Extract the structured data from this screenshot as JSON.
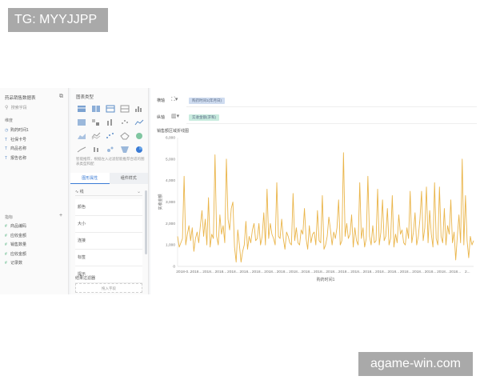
{
  "watermarks": {
    "top": "TG: MYYJJPP",
    "bottom": "agame-win.com"
  },
  "data_panel": {
    "title": "药品销售数据表",
    "search_placeholder": "搜索字段",
    "dimensions_label": "维度",
    "dimensions": [
      {
        "icon": "clock-icon",
        "label": "购药时间1"
      },
      {
        "icon": "text-icon",
        "label": "社保卡号"
      },
      {
        "icon": "text-icon",
        "label": "商品名称"
      },
      {
        "icon": "text-icon",
        "label": "报告名称"
      }
    ],
    "measures_label": "指标",
    "measures_add": "+",
    "measures": [
      {
        "label": "商品编码"
      },
      {
        "label": "应收金额"
      },
      {
        "label": "销售数量"
      },
      {
        "label": "应收金额"
      },
      {
        "label": "记录数"
      }
    ]
  },
  "chart_panel": {
    "title": "图表类型",
    "hint": "智能推荐，根据左入过滤智能推荐合适的图表类型和配",
    "tab_active": "图形属性",
    "tab_inactive": "组件样式",
    "line_selector": "线",
    "properties": [
      "颜色",
      "大小",
      "连接",
      "标签",
      "提示"
    ],
    "filter_title": "结果过滤器",
    "filter_drop": "拖入字段"
  },
  "axes": {
    "x_label": "横轴",
    "x_field": "购药时间1(年月日)",
    "y_label": "纵轴",
    "y_field": "实收金额(求和)"
  },
  "chart_data": {
    "type": "line",
    "title": "销售额区域折线图",
    "xlabel": "购药时间1",
    "ylabel": "实收金额",
    "ylim": [
      0,
      6000
    ],
    "yticks": [
      "0",
      "1,000",
      "2,000",
      "3,000",
      "4,000",
      "5,000",
      "6,000"
    ],
    "x_tick_labels": [
      "2018-0...",
      "2018...",
      "2018...",
      "2018...",
      "2018...",
      "2018...",
      "2018...",
      "2018...",
      "2018...",
      "2018...",
      "2018...",
      "2018...",
      "2018...",
      "2018...",
      "2018...",
      "2018...",
      "2018...",
      "2018...",
      "2018...",
      "2018...",
      "2018...",
      "2018...",
      "2018...",
      "2..."
    ],
    "grid": false,
    "color": "#eab54a",
    "series": [
      {
        "values": [
          1400,
          900,
          1100,
          1300,
          4200,
          1000,
          1500,
          1900,
          1200,
          1800,
          700,
          1300,
          1600,
          1100,
          1900,
          2600,
          1400,
          2200,
          1000,
          3200,
          900,
          1500,
          1300,
          5200,
          1400,
          1000,
          2400,
          1500,
          1900,
          1100,
          5000,
          2200,
          1700,
          2700,
          3000,
          900,
          200,
          1700,
          1000,
          200,
          700,
          1000,
          2100,
          800,
          1400,
          1100,
          1700,
          2000,
          1200,
          1300,
          2000,
          1000,
          1400,
          2500,
          1000,
          3600,
          1300,
          2000,
          1500,
          1300,
          1000,
          3900,
          1400,
          1300,
          2200,
          1300,
          800,
          1600,
          1400,
          1100,
          1000,
          3400,
          1200,
          1800,
          1100,
          1000,
          1700,
          1500,
          2700,
          1300,
          800,
          1900,
          1100,
          1500,
          1600,
          1000,
          2600,
          1200,
          1100,
          3300,
          800,
          1000,
          1400,
          2300,
          1700,
          1000,
          1600,
          1300,
          1800,
          3100,
          1000,
          1200,
          5300,
          1400,
          2000,
          1300,
          1500,
          2400,
          900,
          1800,
          1200,
          1000,
          3900,
          1300,
          1800,
          900,
          1300,
          4200,
          1400,
          1000,
          1900,
          1100,
          1200,
          3600,
          1000,
          1600,
          3100,
          1200,
          1400,
          2700,
          1000,
          1300,
          3300,
          900,
          1500,
          1100,
          2400,
          1500,
          1700,
          1100,
          1000,
          1800,
          1300,
          3500,
          1100,
          1600,
          2500,
          1000,
          1400,
          2200,
          3500,
          1200,
          1800,
          3700,
          1100,
          2600,
          1500,
          900,
          3900,
          1300,
          1000,
          3700,
          1400,
          1100,
          2700,
          1000,
          1900,
          1500,
          3100,
          1100,
          1600,
          300,
          1400,
          2400,
          1100,
          5000,
          1000,
          3300,
          1200,
          400,
          1400,
          1000,
          1200
        ]
      }
    ]
  }
}
